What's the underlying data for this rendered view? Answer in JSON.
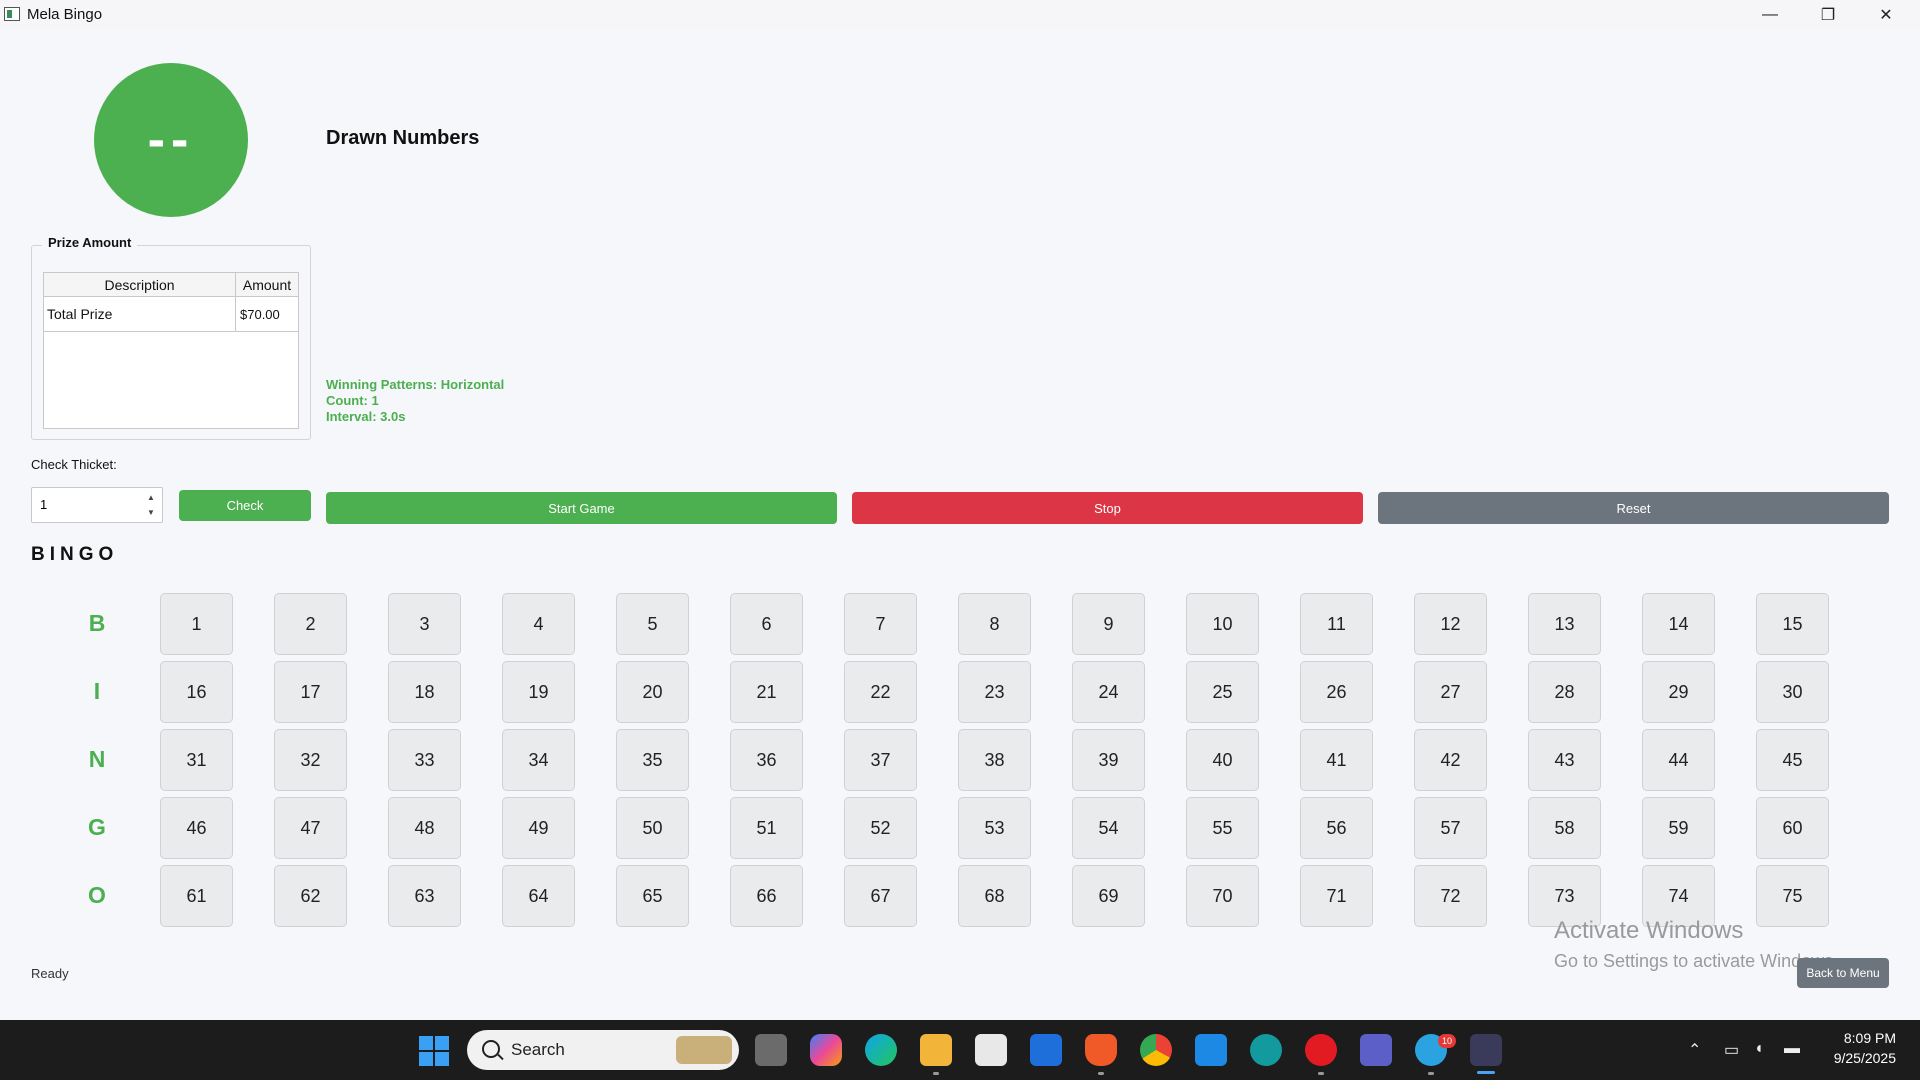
{
  "window": {
    "title": "Mela Bingo",
    "minimize": "—",
    "restore": "❐",
    "close": "✕"
  },
  "ball": {
    "display": "--",
    "color": "#4caf50"
  },
  "drawn_numbers": {
    "title": "Drawn Numbers"
  },
  "prize": {
    "legend": "Prize Amount",
    "headers": [
      "Description",
      "Amount"
    ],
    "rows": [
      {
        "description": "Total Prize",
        "amount": "$70.00"
      }
    ]
  },
  "info": {
    "patterns": "Winning Patterns: Horizontal",
    "count": "Count: 1",
    "interval": "Interval: 3.0s"
  },
  "check": {
    "label": "Check Thicket:",
    "value": "1",
    "button": "Check"
  },
  "controls": {
    "start": "Start Game",
    "stop": "Stop",
    "reset": "Reset"
  },
  "board": {
    "title": "BINGO",
    "letters": [
      "B",
      "I",
      "N",
      "G",
      "O"
    ],
    "numbers": [
      [
        "1",
        "2",
        "3",
        "4",
        "5",
        "6",
        "7",
        "8",
        "9",
        "10",
        "11",
        "12",
        "13",
        "14",
        "15"
      ],
      [
        "16",
        "17",
        "18",
        "19",
        "20",
        "21",
        "22",
        "23",
        "24",
        "25",
        "26",
        "27",
        "28",
        "29",
        "30"
      ],
      [
        "31",
        "32",
        "33",
        "34",
        "35",
        "36",
        "37",
        "38",
        "39",
        "40",
        "41",
        "42",
        "43",
        "44",
        "45"
      ],
      [
        "46",
        "47",
        "48",
        "49",
        "50",
        "51",
        "52",
        "53",
        "54",
        "55",
        "56",
        "57",
        "58",
        "59",
        "60"
      ],
      [
        "61",
        "62",
        "63",
        "64",
        "65",
        "66",
        "67",
        "68",
        "69",
        "70",
        "71",
        "72",
        "73",
        "74",
        "75"
      ]
    ]
  },
  "status": "Ready",
  "watermark": {
    "line1": "Activate Windows",
    "line2": "Go to Settings to activate Windows."
  },
  "back_button": "Back to Menu",
  "taskbar": {
    "search_placeholder": "Search",
    "telegram_badge": "10",
    "time": "8:09 PM",
    "date": "9/25/2025"
  },
  "colors": {
    "green": "#4caf50",
    "red": "#dc3545",
    "gray": "#6c757d"
  }
}
